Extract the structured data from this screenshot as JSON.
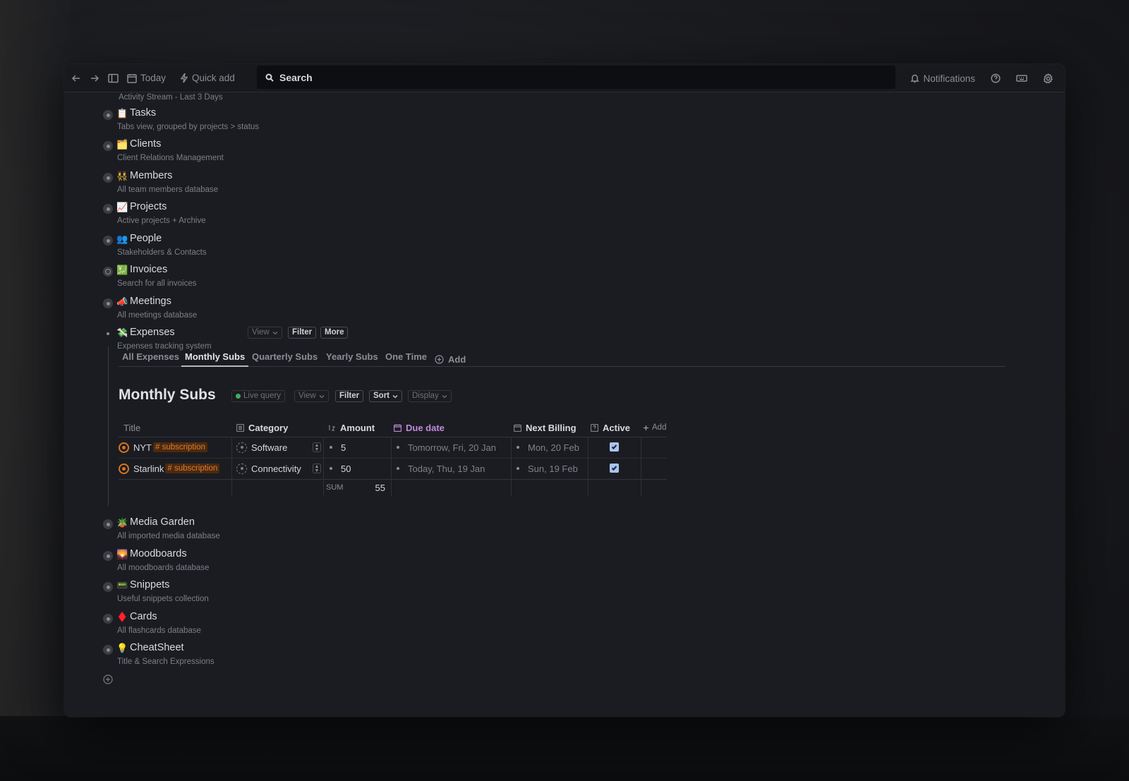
{
  "toolbar": {
    "today_label": "Today",
    "quick_add_label": "Quick add",
    "search_placeholder": "Search",
    "notifications_label": "Notifications"
  },
  "activity_caption": "Activity Stream - Last 3 Days",
  "items_top": [
    {
      "emoji": "📋",
      "title": "Tasks",
      "desc": "Tabs view,  grouped by projects > status"
    },
    {
      "emoji": "🗂️",
      "title": "Clients",
      "desc": "Client Relations Management"
    },
    {
      "emoji": "👯",
      "title": "Members",
      "desc": "All team members database"
    },
    {
      "emoji": "📈",
      "title": "Projects",
      "desc": "Active projects + Archive"
    },
    {
      "emoji": "👥",
      "title": "People",
      "desc": "Stakeholders & Contacts"
    },
    {
      "emoji": "💹",
      "title": "Invoices",
      "desc": "Search for all invoices"
    },
    {
      "emoji": "📣",
      "title": "Meetings",
      "desc": "All meetings database"
    }
  ],
  "expenses": {
    "emoji": "💸",
    "title": "Expenses",
    "desc": "Expenses tracking system",
    "view_label": "View",
    "filter_label": "Filter",
    "more_label": "More",
    "tabs": [
      "All Expenses",
      "Monthly Subs",
      "Quarterly Subs",
      "Yearly Subs",
      "One Time",
      "Add"
    ],
    "active_tab": "Monthly Subs",
    "view_title": "Monthly Subs",
    "live_query_label": "Live query",
    "view2_label": "View",
    "filter2_label": "Filter",
    "sort_label": "Sort",
    "display_label": "Display",
    "table": {
      "headers": {
        "title": "Title",
        "category": "Category",
        "amount": "Amount",
        "due_date": "Due date",
        "next_billing": "Next Billing",
        "active": "Active",
        "add": "Add"
      },
      "rows": [
        {
          "title": "NYT",
          "tag": "# subscription",
          "category": "Software",
          "amount": "5",
          "due_date": "Tomorrow, Fri, 20 Jan",
          "next_billing": "Mon, 20 Feb",
          "active": true
        },
        {
          "title": "Starlink",
          "tag": "# subscription",
          "category": "Connectivity",
          "amount": "50",
          "due_date": "Today, Thu, 19 Jan",
          "next_billing": "Sun, 19 Feb",
          "active": true
        }
      ],
      "sum_label": "SUM",
      "sum_value": "55"
    }
  },
  "items_bottom": [
    {
      "emoji": "🪴",
      "title": "Media Garden",
      "desc": "All imported media database"
    },
    {
      "emoji": "🌄",
      "title": "Moodboards",
      "desc": "All moodboards database"
    },
    {
      "emoji": "📟",
      "title": "Snippets",
      "desc": "Useful snippets collection"
    },
    {
      "emoji": "♦️",
      "title": "Cards",
      "desc": "All flashcards database"
    },
    {
      "emoji": "💡",
      "title": "CheatSheet",
      "desc": "Title & Search Expressions"
    }
  ],
  "colors": {
    "accent_due": "#c08ad8",
    "tag_bg": "#4a2a10",
    "tag_fg": "#e07a2e",
    "live_dot": "#3fae5c",
    "checkbox": "#a9c4ec"
  }
}
